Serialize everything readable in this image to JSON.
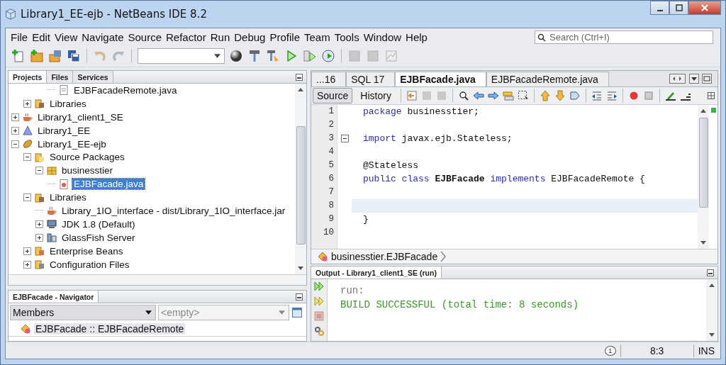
{
  "window": {
    "title": "Library1_EE-ejb - NetBeans IDE 8.2"
  },
  "menu": [
    "File",
    "Edit",
    "View",
    "Navigate",
    "Source",
    "Refactor",
    "Run",
    "Debug",
    "Profile",
    "Team",
    "Tools",
    "Window",
    "Help"
  ],
  "search": {
    "placeholder": "Search (Ctrl+I)"
  },
  "left_tabs": [
    {
      "label": "Projects",
      "selected": true
    },
    {
      "label": "Files",
      "selected": false
    },
    {
      "label": "Services",
      "selected": false
    }
  ],
  "tree": [
    {
      "children": [
        {
          "children": [
            {
              "children": [
                {
                  "label": "EJBFacadeRemote.java",
                  "kind": "java-file",
                  "selected": false
                }
              ]
            }
          ]
        },
        {
          "label": "Libraries",
          "kind": "library-folder",
          "expanded": false,
          "selected": false
        }
      ]
    },
    {
      "label": "Library1_client1_SE",
      "kind": "coffee-cup",
      "expanded": false,
      "selected": false
    },
    {
      "label": "Library1_EE",
      "kind": "triangle",
      "expanded": false,
      "selected": false
    },
    {
      "label": "Library1_EE-ejb",
      "kind": "bean",
      "expanded": true,
      "selected": false,
      "children": [
        {
          "label": "Source Packages",
          "kind": "folder",
          "expanded": true,
          "selected": false,
          "children": [
            {
              "label": "businesstier",
              "kind": "package",
              "expanded": true,
              "selected": false,
              "children": [
                {
                  "label": "EJBFacade.java",
                  "kind": "java-bean",
                  "selected": true
                }
              ]
            }
          ]
        },
        {
          "label": "Libraries",
          "kind": "library-folder",
          "expanded": true,
          "selected": false,
          "children": [
            {
              "label": "Library_1IO_interface - dist/Library_1IO_interface.jar",
              "kind": "coffee-cup",
              "selected": false
            },
            {
              "label": "JDK 1.8 (Default)",
              "kind": "monitor",
              "expanded": false,
              "selected": false
            },
            {
              "label": "GlassFish Server",
              "kind": "server",
              "expanded": false,
              "selected": false
            }
          ]
        },
        {
          "label": "Enterprise Beans",
          "kind": "bean-folder",
          "expanded": false,
          "selected": false
        },
        {
          "label": "Configuration Files",
          "kind": "config-folder",
          "expanded": false,
          "selected": false
        }
      ]
    }
  ],
  "navigator": {
    "title": "EJBFacade - Navigator",
    "filter": "Members",
    "placeholder": "<empty>",
    "items": [
      "EJBFacade :: EJBFacadeRemote"
    ]
  },
  "editor_tabs": [
    {
      "label": "...16",
      "selected": false
    },
    {
      "label": "SQL 17",
      "selected": false
    },
    {
      "label": "EJBFacade.java",
      "selected": true
    },
    {
      "label": "EJBFacadeRemote.java",
      "selected": false
    }
  ],
  "editor_views": [
    {
      "label": "Source",
      "selected": true
    },
    {
      "label": "History",
      "selected": false
    }
  ],
  "code": [
    {
      "number": "1",
      "tokens": [
        {
          "kind": "keyword",
          "text": "package"
        },
        {
          "kind": "plain",
          "text": " businesstier;"
        }
      ]
    },
    {
      "number": "2"
    },
    {
      "number": "3",
      "fold": true,
      "tokens": [
        {
          "kind": "keyword",
          "text": "import"
        },
        {
          "kind": "plain",
          "text": " javax.ejb.Stateless;"
        }
      ]
    },
    {
      "number": "4"
    },
    {
      "number": "5",
      "tokens": [
        {
          "kind": "plain",
          "text": "@Stateless"
        }
      ]
    },
    {
      "number": "6",
      "tokens": [
        {
          "kind": "keyword",
          "text": "public class"
        },
        {
          "kind": "bold",
          "text": " EJBFacade"
        },
        {
          "kind": "keyword",
          "text": " implements"
        },
        {
          "kind": "plain",
          "text": " EJBFacadeRemote {"
        }
      ]
    },
    {
      "number": "7"
    },
    {
      "number": "8",
      "current": true
    },
    {
      "number": "9",
      "tokens": [
        {
          "kind": "plain",
          "text": "}"
        }
      ]
    },
    {
      "number": "10"
    }
  ],
  "breadcrumb": "businesstier.EJBFacade",
  "output": {
    "title": "Output - Library1_client1_SE (run)",
    "lines": [
      {
        "kind": "info",
        "text": "run:"
      },
      {
        "kind": "success",
        "text": "BUILD SUCCESSFUL (total time: 8 seconds)"
      }
    ]
  },
  "status_bar": {
    "notifications": "1",
    "position": "8:3",
    "mode": "INS"
  }
}
